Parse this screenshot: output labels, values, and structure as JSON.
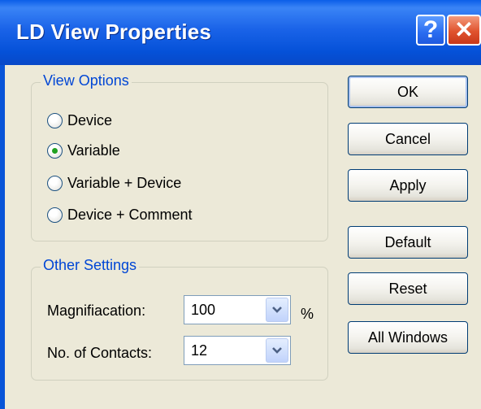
{
  "window": {
    "title": "LD View Properties",
    "help_glyph": "?",
    "close_glyph": "✕"
  },
  "view_options": {
    "label": "View Options",
    "selected": "Variable",
    "options": [
      "Device",
      "Variable",
      "Variable + Device",
      "Device + Comment"
    ]
  },
  "other_settings": {
    "label": "Other Settings",
    "magnification": {
      "label": "Magnifiacation:",
      "value": "100",
      "unit": "%"
    },
    "contacts": {
      "label": "No. of Contacts:",
      "value": "12"
    }
  },
  "buttons": {
    "ok": "OK",
    "cancel": "Cancel",
    "apply": "Apply",
    "default": "Default",
    "reset": "Reset",
    "all_windows": "All Windows"
  },
  "colors": {
    "titlebar": "#0a5ee8",
    "group_label": "#0046d5",
    "dialog_bg": "#ece9d8",
    "radio_selected": "#21a121"
  }
}
